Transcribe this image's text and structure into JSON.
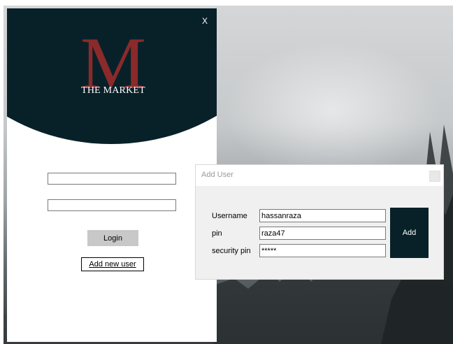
{
  "login_window": {
    "close_label": "X",
    "logo": {
      "initial": "M",
      "name": "THE MARKET"
    },
    "username_value": "",
    "password_value": "",
    "login_label": "Login",
    "add_new_user_label": "Add new user"
  },
  "add_user_dialog": {
    "title": "Add User",
    "fields": [
      {
        "label": "Username",
        "value": "hassanraza"
      },
      {
        "label": "pin",
        "value": "raza47"
      },
      {
        "label": "security pin",
        "value": "*****"
      }
    ],
    "add_label": "Add"
  },
  "colors": {
    "brand_dark": "#082129",
    "logo_red": "#8b2a2a",
    "button_gray": "#c8c8c8"
  }
}
